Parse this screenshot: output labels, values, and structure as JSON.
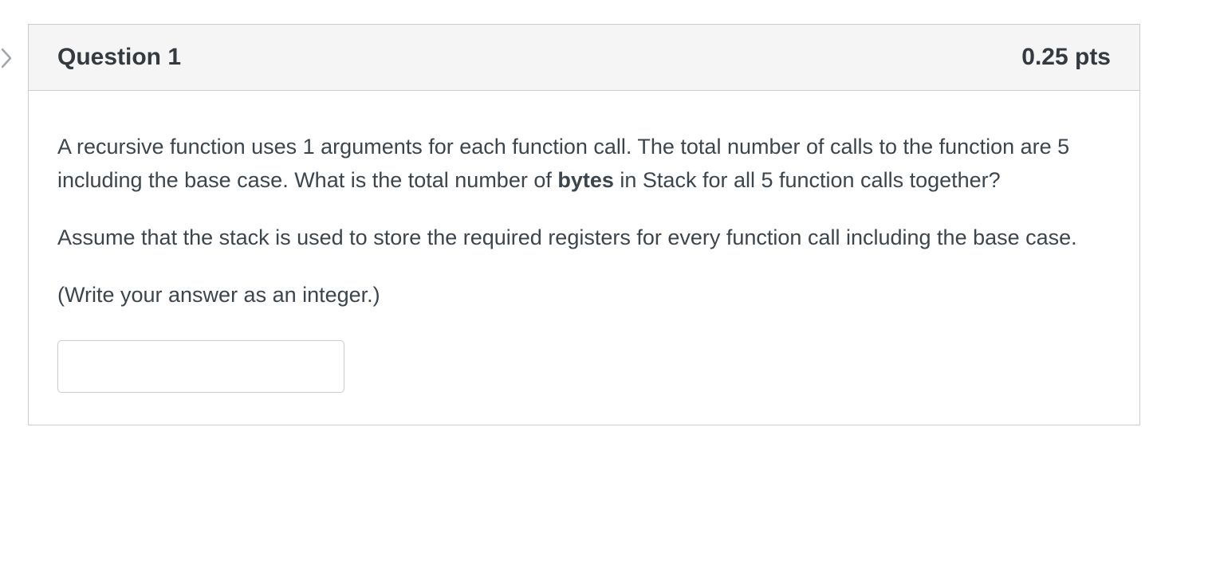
{
  "question": {
    "title": "Question 1",
    "points": "0.25 pts",
    "paragraph1_part1": "A recursive function uses 1 arguments for each function call. The total number of calls to the function are 5 including the base case. What is the total number of ",
    "paragraph1_bold": "bytes",
    "paragraph1_part2": " in Stack for all 5 function calls together?",
    "paragraph2": "Assume that the stack is used to store the required registers for every function call including the base case.",
    "paragraph3": "(Write your answer as an integer.)",
    "answer_value": ""
  }
}
